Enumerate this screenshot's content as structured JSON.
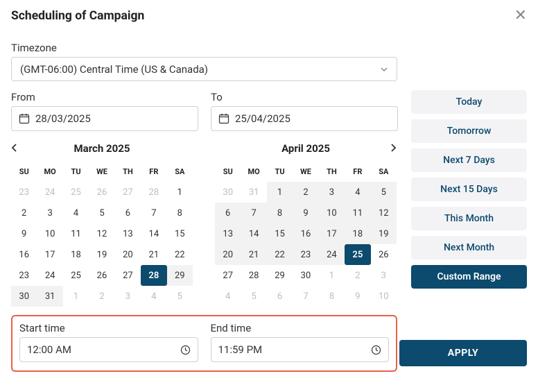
{
  "title": "Scheduling of Campaign",
  "timezone": {
    "label": "Timezone",
    "value": "(GMT-06:00) Central Time (US & Canada)"
  },
  "from": {
    "label": "From",
    "value": "28/03/2025"
  },
  "to": {
    "label": "To",
    "value": "25/04/2025"
  },
  "cal1": {
    "title": "March 2025",
    "dow": [
      "SU",
      "MO",
      "TU",
      "WE",
      "TH",
      "FR",
      "SA"
    ],
    "days": [
      {
        "n": "23",
        "o": 1
      },
      {
        "n": "24",
        "o": 1
      },
      {
        "n": "25",
        "o": 1
      },
      {
        "n": "26",
        "o": 1
      },
      {
        "n": "27",
        "o": 1
      },
      {
        "n": "28",
        "o": 1
      },
      {
        "n": "1"
      },
      {
        "n": "2"
      },
      {
        "n": "3"
      },
      {
        "n": "4"
      },
      {
        "n": "5"
      },
      {
        "n": "6"
      },
      {
        "n": "7"
      },
      {
        "n": "8"
      },
      {
        "n": "9"
      },
      {
        "n": "10"
      },
      {
        "n": "11"
      },
      {
        "n": "12"
      },
      {
        "n": "13"
      },
      {
        "n": "14"
      },
      {
        "n": "15"
      },
      {
        "n": "16"
      },
      {
        "n": "17"
      },
      {
        "n": "18"
      },
      {
        "n": "19"
      },
      {
        "n": "20"
      },
      {
        "n": "21"
      },
      {
        "n": "22"
      },
      {
        "n": "23"
      },
      {
        "n": "24"
      },
      {
        "n": "25"
      },
      {
        "n": "26"
      },
      {
        "n": "27"
      },
      {
        "n": "28",
        "sel": 1
      },
      {
        "n": "29",
        "r": 1
      },
      {
        "n": "30",
        "r": 1
      },
      {
        "n": "31",
        "r": 1
      },
      {
        "n": "1",
        "o": 1
      },
      {
        "n": "2",
        "o": 1
      },
      {
        "n": "3",
        "o": 1
      },
      {
        "n": "4",
        "o": 1
      },
      {
        "n": "5",
        "o": 1
      }
    ]
  },
  "cal2": {
    "title": "April 2025",
    "dow": [
      "SU",
      "MO",
      "TU",
      "WE",
      "TH",
      "FR",
      "SA"
    ],
    "days": [
      {
        "n": "30",
        "o": 1
      },
      {
        "n": "31",
        "o": 1
      },
      {
        "n": "1",
        "r": 1
      },
      {
        "n": "2",
        "r": 1
      },
      {
        "n": "3",
        "r": 1
      },
      {
        "n": "4",
        "r": 1
      },
      {
        "n": "5",
        "r": 1
      },
      {
        "n": "6",
        "r": 1
      },
      {
        "n": "7",
        "r": 1
      },
      {
        "n": "8",
        "r": 1
      },
      {
        "n": "9",
        "r": 1
      },
      {
        "n": "10",
        "r": 1
      },
      {
        "n": "11",
        "r": 1
      },
      {
        "n": "12",
        "r": 1
      },
      {
        "n": "13",
        "r": 1
      },
      {
        "n": "14",
        "r": 1
      },
      {
        "n": "15",
        "r": 1
      },
      {
        "n": "16",
        "r": 1
      },
      {
        "n": "17",
        "r": 1
      },
      {
        "n": "18",
        "r": 1
      },
      {
        "n": "19",
        "r": 1
      },
      {
        "n": "20",
        "r": 1
      },
      {
        "n": "21",
        "r": 1
      },
      {
        "n": "22",
        "r": 1
      },
      {
        "n": "23",
        "r": 1
      },
      {
        "n": "24",
        "r": 1
      },
      {
        "n": "25",
        "sel": 1
      },
      {
        "n": "26"
      },
      {
        "n": "27"
      },
      {
        "n": "28"
      },
      {
        "n": "29"
      },
      {
        "n": "30"
      },
      {
        "n": "1",
        "o": 1
      },
      {
        "n": "2",
        "o": 1
      },
      {
        "n": "3",
        "o": 1
      },
      {
        "n": "4",
        "o": 1
      },
      {
        "n": "5",
        "o": 1
      },
      {
        "n": "6",
        "o": 1
      },
      {
        "n": "7",
        "o": 1
      },
      {
        "n": "8",
        "o": 1
      },
      {
        "n": "9",
        "o": 1
      },
      {
        "n": "10",
        "o": 1
      }
    ]
  },
  "presets": [
    "Today",
    "Tomorrow",
    "Next 7 Days",
    "Next 15 Days",
    "This Month",
    "Next Month",
    "Custom Range"
  ],
  "active_preset": "Custom Range",
  "start_time": {
    "label": "Start time",
    "value": "12:00 AM"
  },
  "end_time": {
    "label": "End time",
    "value": "11:59 PM"
  },
  "apply": "APPLY"
}
